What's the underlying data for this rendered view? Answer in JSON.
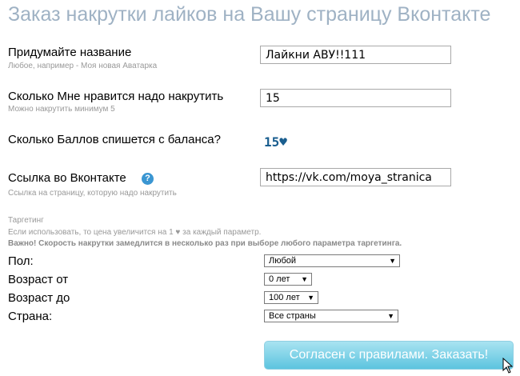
{
  "title": "Заказ накрутки лайков на Вашу страницу Вконтакте",
  "name_field": {
    "label": "Придумайте название",
    "hint": "Любое, например - Моя новая Аватарка",
    "value": "Лайкни АВУ!!111"
  },
  "count_field": {
    "label": "Сколько Мне нравится надо накрутить",
    "hint": "Можно накрутить минимум 5",
    "value": "15"
  },
  "cost": {
    "label": "Сколько Баллов спишется с баланса?",
    "value": "15♥"
  },
  "link_field": {
    "label": "Ссылка во Вконтакте",
    "help_icon": "question-circle-icon",
    "help_glyph": "?",
    "hint": "Ссылка на страницу, которую надо накрутить",
    "value": "https://vk.com/moya_stranica"
  },
  "targeting": {
    "heading": "Таргетинг",
    "note": "Если использовать, то цена увеличится на 1 ♥ за каждый параметр.",
    "warning": "Важно! Скорость накрутки замедлится в несколько раз при выборе любого параметра таргетинга.",
    "gender": {
      "label": "Пол:",
      "value": "Любой"
    },
    "age_from": {
      "label": "Возраст от",
      "value": "0 лет"
    },
    "age_to": {
      "label": "Возраст до",
      "value": "100 лет"
    },
    "country": {
      "label": "Страна:",
      "value": "Все страны"
    }
  },
  "submit_label": "Согласен с правилами. Заказать!",
  "colors": {
    "title": "#9fb2c4",
    "accent": "#5cc4df",
    "cost": "#1a5e8f"
  },
  "icons": {
    "select_arrow": "▼",
    "cursor": "pointer-cursor-icon"
  }
}
